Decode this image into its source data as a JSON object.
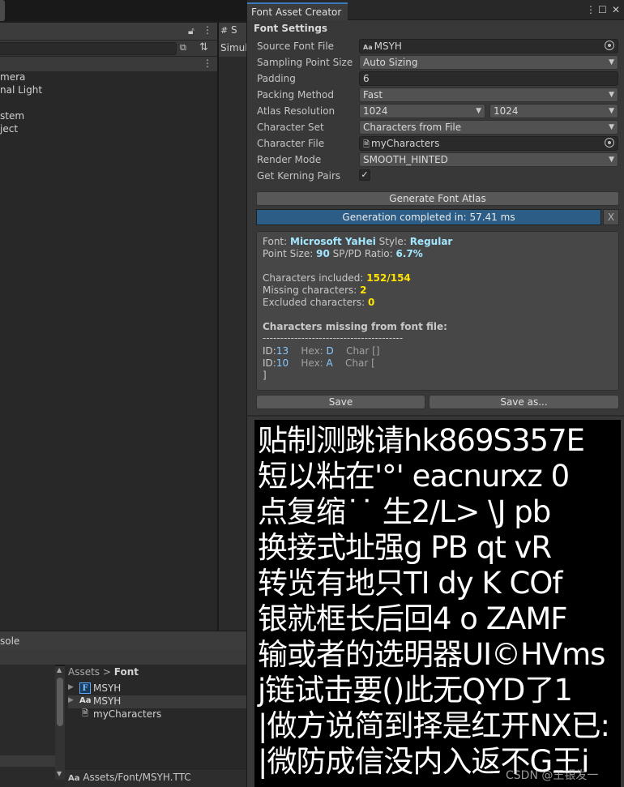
{
  "hierarchy": {
    "items": [
      "mera",
      "nal Light",
      "stem",
      "ject"
    ]
  },
  "scene": {
    "tab_label": "S",
    "sim_label": "Simul"
  },
  "console_tab": "sole",
  "project": {
    "breadcrumb_root": "Assets",
    "breadcrumb_sep": ">",
    "breadcrumb_leaf": "Font",
    "assets": [
      {
        "name": "MSYH",
        "icon": "font-asset-icon"
      },
      {
        "name": "MSYH",
        "icon": "font-file-icon"
      },
      {
        "name": "myCharacters",
        "icon": "text-file-icon"
      }
    ],
    "path": "Assets/Font/MSYH.TTC",
    "path_icon_text": "Aa"
  },
  "window": {
    "title": "Font Asset Creator",
    "menu_glyph": "⋮",
    "max_glyph": "☐",
    "close_glyph": "✕"
  },
  "settings": {
    "section_title": "Font Settings",
    "source_font_label": "Source Font File",
    "source_font_value": "MSYH",
    "sampling_label": "Sampling Point Size",
    "sampling_value": "Auto Sizing",
    "padding_label": "Padding",
    "padding_value": "6",
    "packing_label": "Packing Method",
    "packing_value": "Fast",
    "atlas_label": "Atlas Resolution",
    "atlas_w": "1024",
    "atlas_h": "1024",
    "charset_label": "Character Set",
    "charset_value": "Characters from File",
    "charfile_label": "Character File",
    "charfile_value": "myCharacters",
    "render_label": "Render Mode",
    "render_value": "SMOOTH_HINTED",
    "kerning_label": "Get Kerning Pairs",
    "kerning_checked": true
  },
  "actions": {
    "generate_label": "Generate Font Atlas",
    "progress_text": "Generation completed in: 57.41 ms",
    "progress_close": "X",
    "save_label": "Save",
    "save_as_label": "Save as..."
  },
  "report": {
    "font_label": "Font:",
    "font_value": "Microsoft YaHei",
    "style_label": "Style:",
    "style_value": "Regular",
    "point_label": "Point Size:",
    "point_value": "90",
    "ratio_label": "SP/PD Ratio:",
    "ratio_value": "6.7%",
    "included_label": "Characters included:",
    "included_value": "152/154",
    "missing_label": "Missing characters:",
    "missing_value": "2",
    "excluded_label": "Excluded characters:",
    "excluded_value": "0",
    "missing_header": "Characters missing from font file:",
    "divider": "----------------------------------------",
    "missing_rows": [
      {
        "id_label": "ID:",
        "id": "13",
        "hex_label": "Hex:",
        "hex": "D",
        "char_label": "Char",
        "char": "[]"
      },
      {
        "id_label": "ID:",
        "id": "10",
        "hex_label": "Hex:",
        "hex": "A",
        "char_label": "Char",
        "char": "["
      }
    ],
    "trailing": "]"
  },
  "atlas_preview": {
    "rows": [
      "贴制测跳请hk869S357E",
      "短以粘在'°' eacnurxz 0",
      "点复缩˙˙ 生2/L>  \\J pb",
      "换接式址强g  PB qt vR",
      "转览有地只TI dy K COf",
      "银就框长后回4 o ZAMF",
      "输或者的选明器UI©HVms",
      "j链试击要()此无QYD了1",
      "|做方说简到择是红开NX已:",
      "|微防成信没内入返不G王i"
    ],
    "watermark": "CSDN @王银发一"
  },
  "colors": {
    "accent": "#3a79bb",
    "progress": "#2c5d87",
    "highlight_cyan": "#a2e7ff",
    "highlight_yellow": "#ffe400"
  }
}
